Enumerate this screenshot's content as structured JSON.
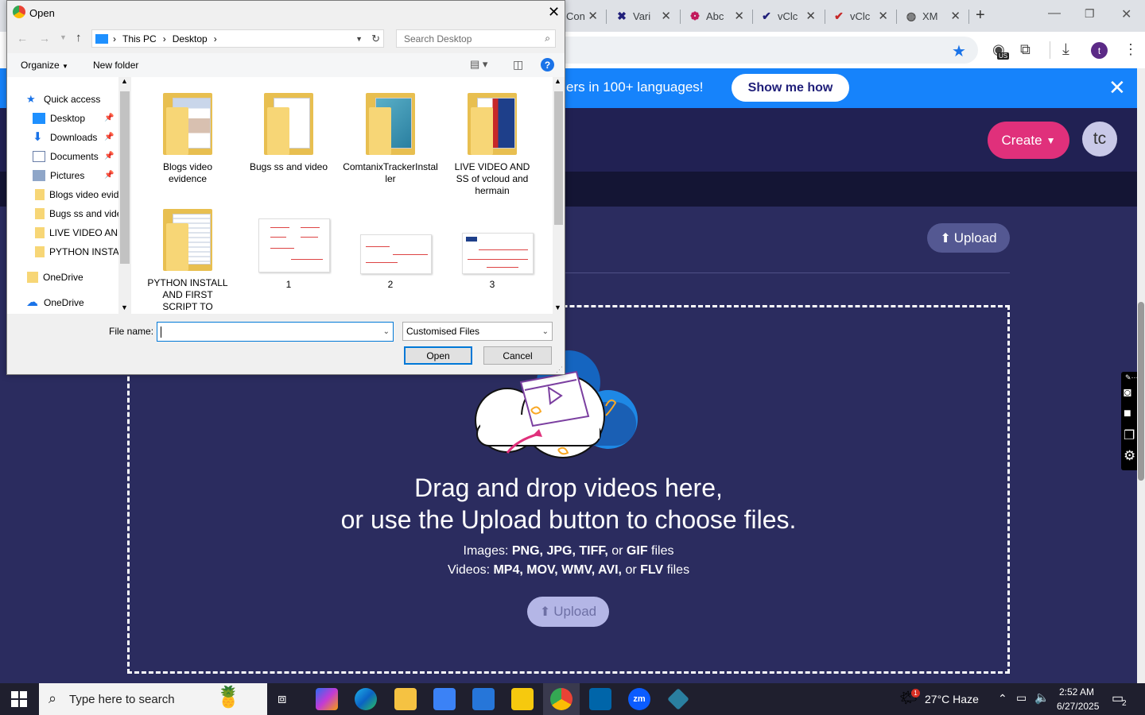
{
  "browser": {
    "tabs": [
      {
        "label": "Con",
        "icon": "tab-site-icon"
      },
      {
        "label": "Vari",
        "icon": "x-logo-icon"
      },
      {
        "label": "Abc",
        "icon": "abc-site-icon"
      },
      {
        "label": "vClc",
        "icon": "vcloud-icon"
      },
      {
        "label": "vClc",
        "icon": "vcloud-red-icon"
      },
      {
        "label": "XM",
        "icon": "globe-icon"
      }
    ],
    "new_tab": "+",
    "profile_initial": "t",
    "extension_badge": "US"
  },
  "banner": {
    "text": "ers in 100+ languages!",
    "button": "Show me how",
    "close": "✕"
  },
  "app": {
    "create_label": "Create",
    "avatar_initials": "tc",
    "upload_label": "Upload",
    "drop_line1": "Drag and drop videos here,",
    "drop_line2": "or use the Upload button to choose files.",
    "images_prefix": "Images:",
    "images_formats": "PNG, JPG, TIFF,",
    "images_or": "or",
    "images_gif": "GIF",
    "images_suffix": "files",
    "videos_prefix": "Videos:",
    "videos_formats": "MP4, MOV, WMV, AVI,",
    "videos_or": "or",
    "videos_flv": "FLV",
    "videos_suffix": "files",
    "upload_bottom_label": "Upload"
  },
  "dialog": {
    "title": "Open",
    "path": [
      "This PC",
      "Desktop"
    ],
    "search_placeholder": "Search Desktop",
    "organize": "Organize",
    "new_folder": "New folder",
    "nav": [
      {
        "label": "Quick access",
        "icon": "star-icon",
        "pinned": false
      },
      {
        "label": "Desktop",
        "icon": "desktop-icon",
        "pinned": true
      },
      {
        "label": "Downloads",
        "icon": "download-arrow-icon",
        "pinned": true
      },
      {
        "label": "Documents",
        "icon": "document-icon",
        "pinned": true
      },
      {
        "label": "Pictures",
        "icon": "pictures-icon",
        "pinned": true
      },
      {
        "label": "Blogs video evid",
        "icon": "folder-icon",
        "pinned": false
      },
      {
        "label": "Bugs ss and vide",
        "icon": "folder-icon",
        "pinned": false
      },
      {
        "label": "LIVE VIDEO AND",
        "icon": "folder-icon",
        "pinned": false
      },
      {
        "label": "PYTHON INSTAL",
        "icon": "folder-icon",
        "pinned": false
      },
      {
        "label": "OneDrive",
        "icon": "folder-icon",
        "pinned": false
      },
      {
        "label": "OneDrive",
        "icon": "cloud-icon",
        "pinned": false
      }
    ],
    "files": [
      {
        "name": "Blogs video evidence",
        "kind": "folder"
      },
      {
        "name": "Bugs ss and video",
        "kind": "folder"
      },
      {
        "name": "ComtanixTrackerInstaller",
        "kind": "folder"
      },
      {
        "name": "LIVE VIDEO AND SS of vcloud and hermain",
        "kind": "folder"
      },
      {
        "name": "PYTHON INSTALL AND FIRST SCRIPT TO",
        "kind": "folder"
      },
      {
        "name": "1",
        "kind": "image"
      },
      {
        "name": "2",
        "kind": "image"
      },
      {
        "name": "3",
        "kind": "image"
      }
    ],
    "file_name_label": "File name:",
    "file_name_value": "",
    "file_type": "Customised Files",
    "open_label": "Open",
    "cancel_label": "Cancel"
  },
  "taskbar": {
    "search_placeholder": "Type here to search",
    "weather": "27°C  Haze",
    "weather_badge": "1",
    "time": "2:52 AM",
    "date": "6/27/2025",
    "notifications": "2"
  }
}
